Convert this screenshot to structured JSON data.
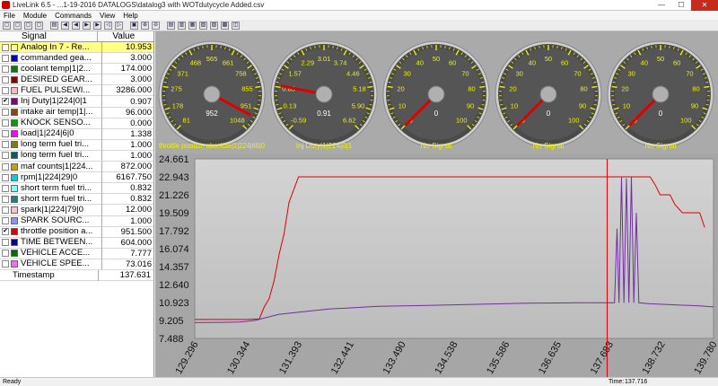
{
  "window": {
    "title": "LiveLink 6.5 - ...1-19-2016 DATALOGS\\datalog3 with WOTdutycycle Added.csv",
    "min": "—",
    "max": "☐",
    "close": "✕"
  },
  "menu": [
    "File",
    "Module",
    "Commands",
    "View",
    "Help"
  ],
  "toolbar": {
    "button_count": 21
  },
  "signals": {
    "header": {
      "name": "Signal",
      "value": "Value"
    },
    "rows": [
      {
        "checked": false,
        "color": "#ffff80",
        "name": "Analog In 7 - Re...",
        "value": "10.953",
        "highlight": true
      },
      {
        "checked": false,
        "color": "#0000cc",
        "name": "commanded gea...",
        "value": "3.000"
      },
      {
        "checked": false,
        "color": "#008000",
        "name": "coolant temp|1|2...",
        "value": "174.000"
      },
      {
        "checked": false,
        "color": "#8b0000",
        "name": "DESIRED GEAR...",
        "value": "3.000"
      },
      {
        "checked": false,
        "color": "#ffb6c1",
        "name": "FUEL PULSEWI...",
        "value": "3286.000"
      },
      {
        "checked": true,
        "color": "#800080",
        "name": "Inj Duty|1|224|0|1",
        "value": "0.907"
      },
      {
        "checked": false,
        "color": "#8b4513",
        "name": "intake air temp|1|...",
        "value": "96.000"
      },
      {
        "checked": false,
        "color": "#00a000",
        "name": "KNOCK SENSO...",
        "value": "0.000"
      },
      {
        "checked": false,
        "color": "#ff00ff",
        "name": "load|1|224|6|0",
        "value": "1.338"
      },
      {
        "checked": false,
        "color": "#808000",
        "name": "long term fuel tri...",
        "value": "1.000"
      },
      {
        "checked": false,
        "color": "#006060",
        "name": "long term fuel tri...",
        "value": "1.000"
      },
      {
        "checked": false,
        "color": "#c8a000",
        "name": "maf counts|1|224...",
        "value": "872.000"
      },
      {
        "checked": false,
        "color": "#00d0e0",
        "name": "rpm|1|224|29|0",
        "value": "6167.750"
      },
      {
        "checked": false,
        "color": "#80ffff",
        "name": "short term fuel tri...",
        "value": "0.832"
      },
      {
        "checked": false,
        "color": "#208080",
        "name": "short term fuel tri...",
        "value": "0.832"
      },
      {
        "checked": false,
        "color": "#ffc0cb",
        "name": "spark|1|224|79|0",
        "value": "12.000"
      },
      {
        "checked": false,
        "color": "#9090ff",
        "name": "SPARK SOURC...",
        "value": "1.000"
      },
      {
        "checked": true,
        "color": "#e00000",
        "name": "throttle position a...",
        "value": "951.500"
      },
      {
        "checked": false,
        "color": "#0000a0",
        "name": "TIME BETWEEN...",
        "value": "604.000"
      },
      {
        "checked": false,
        "color": "#007000",
        "name": "VEHICLE ACCE...",
        "value": "7.777"
      },
      {
        "checked": false,
        "color": "#ff66ff",
        "name": "VEHICLE SPEE...",
        "value": "73.016"
      }
    ],
    "timestamp": {
      "name": "Timestamp",
      "value": "137.631"
    }
  },
  "gauges": [
    {
      "label": "throttle position absolute|1|224|66|0",
      "readout": "952",
      "ticks": [
        "81",
        "178",
        "275",
        "371",
        "468",
        "565",
        "661",
        "758",
        "855",
        "951",
        "1048"
      ],
      "needle": 0.938
    },
    {
      "label": "Inj Duty|1|224|0|1",
      "readout": "0.91",
      "ticks": [
        "-0.59",
        "0.13",
        "0.85",
        "1.57",
        "2.29",
        "3.01",
        "3.74",
        "4.46",
        "5.18",
        "5.90",
        "6.62"
      ],
      "needle": 0.208
    },
    {
      "label": "No Signal",
      "readout": "0",
      "ticks": [
        "0",
        "10",
        "20",
        "30",
        "40",
        "50",
        "60",
        "70",
        "80",
        "90",
        "100"
      ],
      "needle": 0.0
    },
    {
      "label": "No Signal",
      "readout": "0",
      "ticks": [
        "0",
        "10",
        "20",
        "30",
        "40",
        "50",
        "60",
        "70",
        "80",
        "90",
        "100"
      ],
      "needle": 0.0
    },
    {
      "label": "No Signal",
      "readout": "0",
      "ticks": [
        "0",
        "10",
        "20",
        "30",
        "40",
        "50",
        "60",
        "70",
        "80",
        "90",
        "100"
      ],
      "needle": 0.0
    }
  ],
  "chart_data": {
    "type": "line",
    "x_ticks": [
      "129.296",
      "130.344",
      "131.393",
      "132.441",
      "133.490",
      "134.538",
      "135.586",
      "136.635",
      "137.683",
      "138.732",
      "139.780"
    ],
    "y_ticks": [
      "24.661",
      "22.943",
      "21.226",
      "19.509",
      "17.792",
      "16.074",
      "14.357",
      "12.640",
      "10.923",
      "9.205",
      "7.488"
    ],
    "xlim": [
      129.296,
      139.78
    ],
    "ylim": [
      7.488,
      24.661
    ],
    "cursor_x": 137.63,
    "grid": false,
    "series": [
      {
        "color": "#e00000",
        "x": [
          129.296,
          129.9,
          130.1,
          130.344,
          130.6,
          130.7,
          130.8,
          130.9,
          131.0,
          131.1,
          131.2,
          131.393,
          132.0,
          134.0,
          136.0,
          137.683,
          138.2,
          138.5,
          138.6,
          138.7,
          138.9,
          139.0,
          139.15,
          139.3,
          139.5,
          139.6
        ],
        "y": [
          9.3,
          9.3,
          9.3,
          9.3,
          9.35,
          10.5,
          11.3,
          13.0,
          15.5,
          17.5,
          20.5,
          22.943,
          22.943,
          22.943,
          22.943,
          22.943,
          22.943,
          22.943,
          22.2,
          21.226,
          21.226,
          20.3,
          19.509,
          19.509,
          19.509,
          18.1
        ]
      },
      {
        "color": "#7030a0",
        "x": [
          129.296,
          130.2,
          130.5,
          131.0,
          132.0,
          133.0,
          134.0,
          135.0,
          136.0,
          137.0,
          137.683,
          137.78,
          137.83,
          137.87,
          137.92,
          137.97,
          138.02,
          138.07,
          138.12,
          138.17,
          138.22,
          138.27,
          138.5,
          139.0,
          139.5,
          139.78
        ],
        "y": [
          9.0,
          9.05,
          9.2,
          9.8,
          10.3,
          10.55,
          10.65,
          10.75,
          10.85,
          10.9,
          10.9,
          10.9,
          18.0,
          10.9,
          22.943,
          10.9,
          22.8,
          10.9,
          22.943,
          10.9,
          19.5,
          10.9,
          10.8,
          10.7,
          10.6,
          10.5
        ]
      }
    ]
  },
  "status": {
    "left": "Ready",
    "time_label": "Time:",
    "time_value": "137.716"
  }
}
